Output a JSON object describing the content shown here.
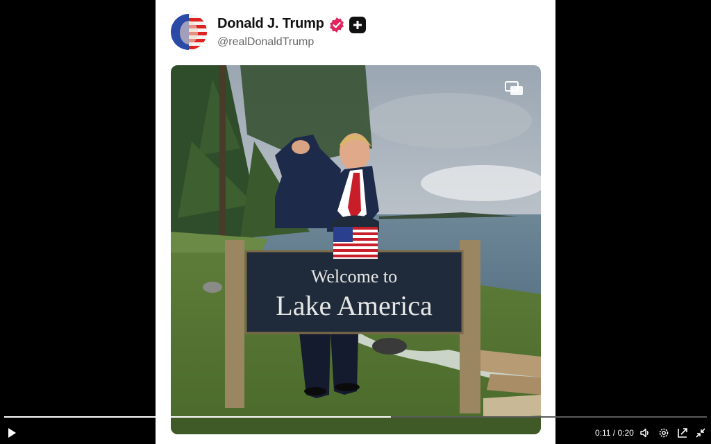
{
  "post": {
    "author_name": "Donald J. Trump",
    "handle": "@realDonaldTrump",
    "verified": true,
    "badge_icon": "plus-icon"
  },
  "media": {
    "sign_line1": "Welcome to",
    "sign_line2": "Lake America",
    "gallery_icon": "gallery-icon"
  },
  "player": {
    "current_time": "0:11",
    "duration": "0:20",
    "time_display": "0:11 / 0:20",
    "progress_fraction": 0.55,
    "icons": [
      "play-icon",
      "volume-icon",
      "settings-icon",
      "picture-in-picture-icon",
      "exit-fullscreen-icon"
    ]
  },
  "colors": {
    "verified": "#e0245e",
    "background": "#000000",
    "card": "#ffffff",
    "sign": "#1f2b3a"
  }
}
